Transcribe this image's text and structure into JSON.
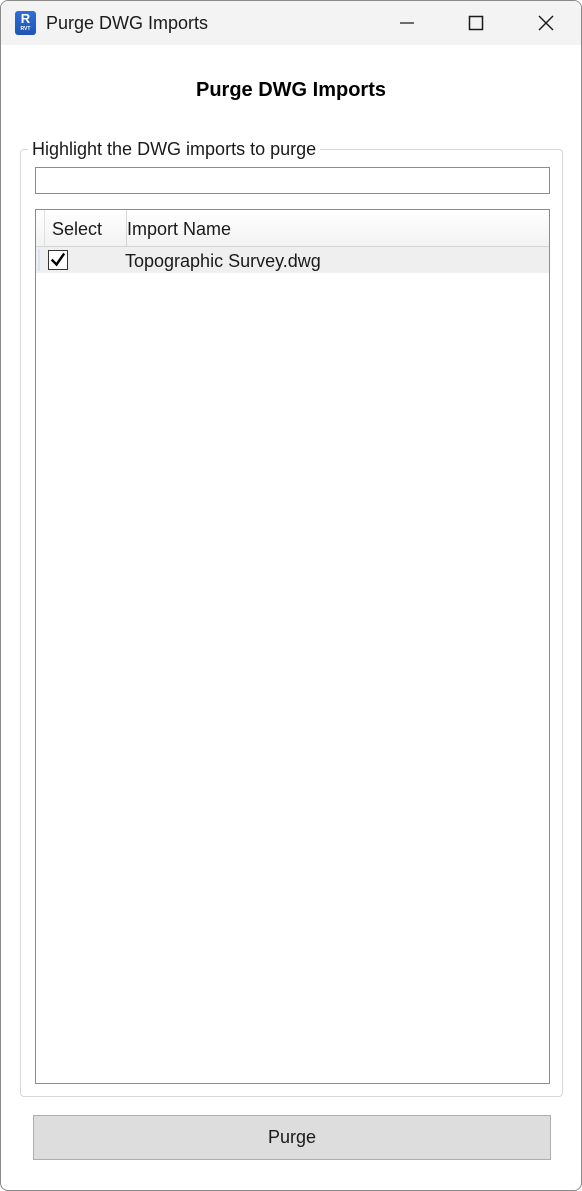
{
  "window": {
    "title": "Purge DWG Imports",
    "app_icon": {
      "name": "revit-icon",
      "letter": "R",
      "sub": "RVT"
    }
  },
  "heading": "Purge DWG Imports",
  "group": {
    "legend": "Highlight the DWG imports to purge",
    "filter": {
      "value": "",
      "placeholder": ""
    }
  },
  "grid": {
    "columns": [
      "Select",
      "Import Name"
    ],
    "rows": [
      {
        "selected": true,
        "import_name": "Topographic Survey.dwg"
      }
    ]
  },
  "footer": {
    "purge_label": "Purge"
  },
  "colors": {
    "titlebar": "#f3f3f3",
    "button": "#dddddd",
    "row_highlight": "#efefef",
    "app_icon": "#2f6fd6"
  }
}
